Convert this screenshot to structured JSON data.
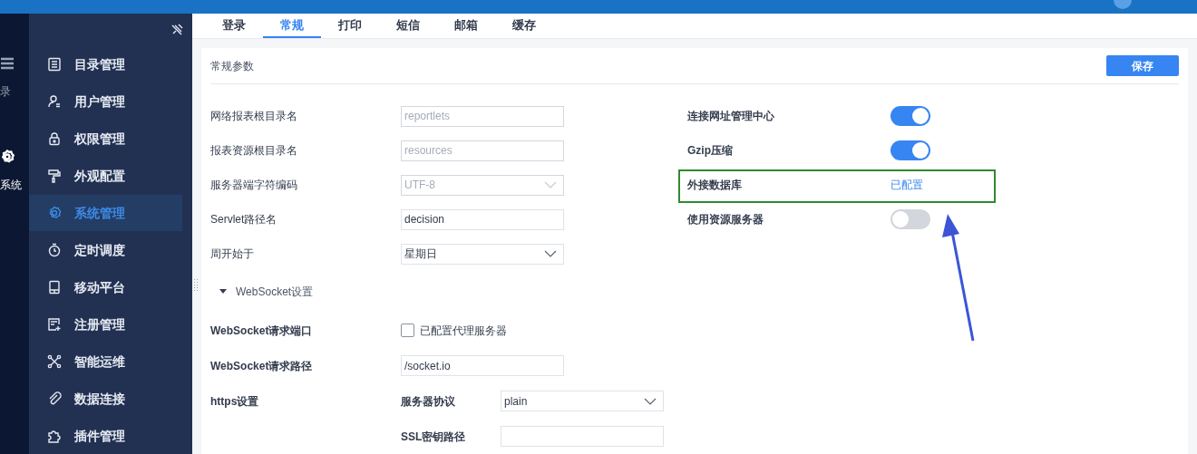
{
  "rail": {
    "items": [
      {
        "label": "录"
      },
      {
        "label": "系统"
      }
    ]
  },
  "sidebar": {
    "items": [
      {
        "label": "目录管理",
        "selected": false
      },
      {
        "label": "用户管理",
        "selected": false
      },
      {
        "label": "权限管理",
        "selected": false
      },
      {
        "label": "外观配置",
        "selected": false
      },
      {
        "label": "系统管理",
        "selected": true
      },
      {
        "label": "定时调度",
        "selected": false
      },
      {
        "label": "移动平台",
        "selected": false
      },
      {
        "label": "注册管理",
        "selected": false
      },
      {
        "label": "智能运维",
        "selected": false
      },
      {
        "label": "数据连接",
        "selected": false
      },
      {
        "label": "插件管理",
        "selected": false
      }
    ]
  },
  "tabs": [
    {
      "label": "登录",
      "selected": false
    },
    {
      "label": "常规",
      "selected": true
    },
    {
      "label": "打印",
      "selected": false
    },
    {
      "label": "短信",
      "selected": false
    },
    {
      "label": "邮箱",
      "selected": false
    },
    {
      "label": "缓存",
      "selected": false
    }
  ],
  "panel": {
    "title": "常规参数",
    "save_button": "保存",
    "left_rows": [
      {
        "label": "网络报表根目录名",
        "kind": "input",
        "value": "reportlets",
        "disabled": true
      },
      {
        "label": "报表资源根目录名",
        "kind": "input",
        "value": "resources",
        "disabled": true
      },
      {
        "label": "服务器端字符编码",
        "kind": "select",
        "value": "UTF-8",
        "disabled": true
      },
      {
        "label": "Servlet路径名",
        "kind": "input",
        "value": "decision",
        "disabled": false
      },
      {
        "label": "周开始于",
        "kind": "select",
        "value": "星期日",
        "disabled": false
      }
    ],
    "section": {
      "label": "WebSocket设置",
      "expanded": true,
      "rows": [
        {
          "label": "WebSocket请求端口",
          "kind": "checkbox",
          "text": "已配置代理服务器",
          "checked": false
        },
        {
          "label": "WebSocket请求路径",
          "kind": "input",
          "value": "/socket.io"
        },
        {
          "label": "https设置",
          "kind": "select",
          "sublabel": "服务器协议",
          "value": "plain"
        },
        {
          "kind": "input",
          "sublabel": "SSL密钥路径"
        }
      ]
    },
    "right_rows": [
      {
        "label": "连接网址管理中心",
        "kind": "toggle",
        "on": true
      },
      {
        "label": "Gzip压缩",
        "kind": "toggle",
        "on": true
      },
      {
        "label": "外接数据库",
        "kind": "link",
        "text": "已配置",
        "highlighted": true
      },
      {
        "label": "使用资源服务器",
        "kind": "toggle",
        "on": false
      }
    ]
  }
}
